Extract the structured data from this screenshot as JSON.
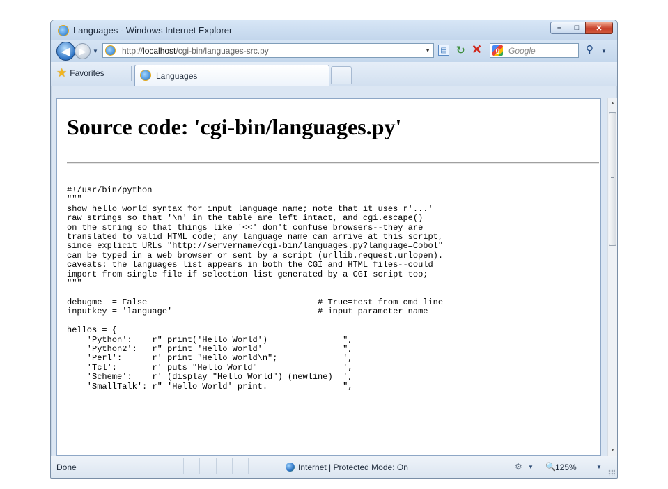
{
  "window": {
    "title": "Languages - Windows Internet Explorer",
    "minimize": "–",
    "maximize": "□",
    "close": "✕"
  },
  "nav": {
    "back": "◀",
    "forward": "▶",
    "dropdown": "▼",
    "address_prefix": "http://",
    "address_host": "localhost",
    "address_path": "/cgi-bin/languages-src.py",
    "address_dropdown": "▼",
    "compat_icon": "▤",
    "refresh": "↻",
    "stop": "✕",
    "search_placeholder": "Google",
    "search_logo": "g",
    "search_button": "⚲",
    "search_dropdown": "▼"
  },
  "favorites": {
    "star": "★",
    "label": "Favorites",
    "tab_label": "Languages"
  },
  "page": {
    "title": "Source code: 'cgi-bin/languages.py'",
    "source": "#!/usr/bin/python\n\"\"\"\nshow hello world syntax for input language name; note that it uses r'...'\nraw strings so that '\\n' in the table are left intact, and cgi.escape()\non the string so that things like '<<' don't confuse browsers--they are\ntranslated to valid HTML code; any language name can arrive at this script,\nsince explicit URLs \"http://servername/cgi-bin/languages.py?language=Cobol\"\ncan be typed in a web browser or sent by a script (urllib.request.urlopen).\ncaveats: the languages list appears in both the CGI and HTML files--could\nimport from single file if selection list generated by a CGI script too;\n\"\"\"\n\ndebugme  = False                                  # True=test from cmd line\ninputkey = 'language'                             # input parameter name\n\nhellos = {\n    'Python':    r\" print('Hello World')               \",\n    'Python2':   r\" print 'Hello World'                \",\n    'Perl':      r' print \"Hello World\\n\";             ',\n    'Tcl':       r' puts \"Hello World\"                 ',\n    'Scheme':    r' (display \"Hello World\") (newline)  ',\n    'SmallTalk': r\" 'Hello World' print.               \","
  },
  "scrollbar": {
    "up": "▲",
    "down": "▼"
  },
  "status": {
    "text": "Done",
    "zone": "Internet | Protected Mode: On",
    "security_icon": "⚙",
    "security_dropdown": "▼",
    "zoom_icon": "🔍",
    "zoom": "125%",
    "zoom_dropdown": "▼"
  }
}
